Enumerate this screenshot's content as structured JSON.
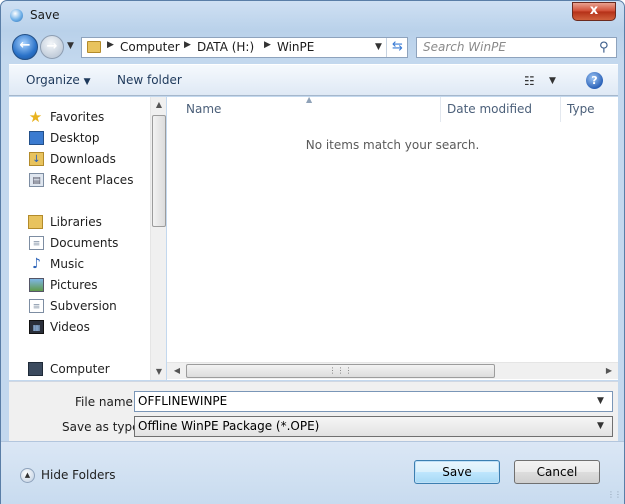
{
  "window": {
    "title": "Save",
    "close_label": "x"
  },
  "nav": {
    "back_icon": "back-arrow-icon",
    "forward_icon": "forward-arrow-icon",
    "breadcrumb": [
      "Computer",
      "DATA (H:)",
      "WinPE"
    ],
    "search_placeholder": "Search WinPE"
  },
  "toolbar": {
    "organize_label": "Organize",
    "new_folder_label": "New folder"
  },
  "sidebar": {
    "favorites": {
      "label": "Favorites",
      "items": [
        {
          "label": "Desktop",
          "icon": "desktop-icon"
        },
        {
          "label": "Downloads",
          "icon": "downloads-icon"
        },
        {
          "label": "Recent Places",
          "icon": "recent-places-icon"
        }
      ]
    },
    "libraries": {
      "label": "Libraries",
      "items": [
        {
          "label": "Documents",
          "icon": "documents-icon"
        },
        {
          "label": "Music",
          "icon": "music-icon"
        },
        {
          "label": "Pictures",
          "icon": "pictures-icon"
        },
        {
          "label": "Subversion",
          "icon": "subversion-icon"
        },
        {
          "label": "Videos",
          "icon": "videos-icon"
        }
      ]
    },
    "computer": {
      "label": "Computer"
    }
  },
  "file_list": {
    "columns": [
      "Name",
      "Date modified",
      "Type"
    ],
    "empty_message": "No items match your search."
  },
  "form": {
    "file_name_label": "File name:",
    "file_name_value": "OFFLINEWINPE",
    "save_type_label": "Save as type:",
    "save_type_value": "Offline WinPE Package (*.OPE)"
  },
  "footer": {
    "hide_folders_label": "Hide Folders",
    "save_label": "Save",
    "cancel_label": "Cancel"
  }
}
